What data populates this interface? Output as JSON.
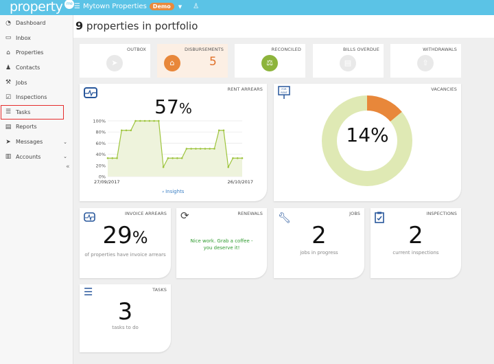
{
  "app": {
    "logo": "property",
    "logo_badge": "me",
    "org_name": "Mytown Properties",
    "org_badge": "Demo"
  },
  "sidebar": {
    "items": [
      {
        "label": "Dashboard",
        "icon": "dashboard-icon"
      },
      {
        "label": "Inbox",
        "icon": "inbox-icon"
      },
      {
        "label": "Properties",
        "icon": "home-icon"
      },
      {
        "label": "Contacts",
        "icon": "user-icon"
      },
      {
        "label": "Jobs",
        "icon": "wrench-icon"
      },
      {
        "label": "Inspections",
        "icon": "clipboard-check-icon"
      },
      {
        "label": "Tasks",
        "icon": "list-icon",
        "selected": true
      },
      {
        "label": "Reports",
        "icon": "report-icon"
      },
      {
        "label": "Messages",
        "icon": "send-icon",
        "expandable": true
      },
      {
        "label": "Accounts",
        "icon": "book-icon",
        "expandable": true
      }
    ]
  },
  "header": {
    "count": "9",
    "title": "properties in portfolio"
  },
  "tiles": [
    {
      "title": "OUTBOX",
      "value": "",
      "icon": "paper-plane-icon"
    },
    {
      "title": "DISBURSEMENTS",
      "value": "5",
      "icon": "houses-icon",
      "color": "#e8873a"
    },
    {
      "title": "RECONCILED",
      "value": "",
      "icon": "scales-icon",
      "color": "#8db43c"
    },
    {
      "title": "BILLS OVERDUE",
      "value": "",
      "icon": "bill-icon"
    },
    {
      "title": "WITHDRAWALS",
      "value": "",
      "icon": "upload-icon"
    }
  ],
  "rent_arrears": {
    "title": "RENT ARREARS",
    "value": "57",
    "unit": "%",
    "insights": "Insights"
  },
  "chart_data": {
    "type": "area",
    "ylim": [
      0,
      100
    ],
    "yticks": [
      "0%",
      "20%",
      "40%",
      "60%",
      "80%",
      "100%"
    ],
    "xlabels": [
      "27/09/2017",
      "26/10/2017"
    ],
    "values": [
      33,
      33,
      33,
      83,
      83,
      83,
      100,
      100,
      100,
      100,
      100,
      100,
      17,
      33,
      33,
      33,
      33,
      50,
      50,
      50,
      50,
      50,
      50,
      50,
      83,
      83,
      17,
      33,
      33,
      33
    ],
    "line_color": "#9dc43c",
    "fill_color": "#eef3dc",
    "grid": true
  },
  "vacancies": {
    "title": "VACANCIES",
    "value": "14%",
    "percent": 14,
    "colors": {
      "vacant": "#e8873a",
      "occupied": "#dfe9b4"
    }
  },
  "invoice_arrears": {
    "title": "INVOICE ARREARS",
    "value": "29",
    "unit": "%",
    "caption": "of properties have invoice arrears"
  },
  "renewals": {
    "title": "RENEWALS",
    "message": "Nice work. Grab a coffee - you deserve it!"
  },
  "jobs": {
    "title": "JOBS",
    "value": "2",
    "caption": "jobs in progress"
  },
  "inspections": {
    "title": "INSPECTIONS",
    "value": "2",
    "caption": "current inspections"
  },
  "tasks": {
    "title": "TASKS",
    "value": "3",
    "caption": "tasks to do"
  }
}
